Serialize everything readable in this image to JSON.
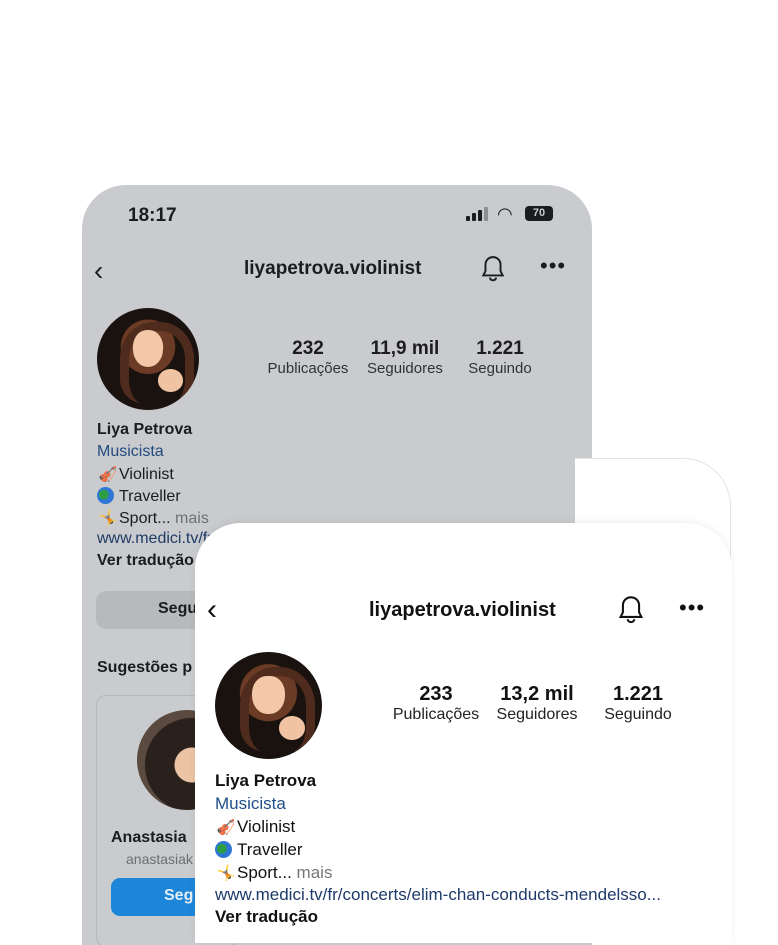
{
  "back_screen": {
    "status": {
      "time": "18:17",
      "battery": "70"
    },
    "header": {
      "username": "liyapetrova.violinist"
    },
    "stats": [
      {
        "value": "232",
        "label": "Publicações"
      },
      {
        "value": "11,9 mil",
        "label": "Seguidores"
      },
      {
        "value": "1.221",
        "label": "Seguindo"
      }
    ],
    "profile": {
      "name": "Liya Petrova",
      "category": "Musicista",
      "bio": [
        {
          "icon": "violin-emoji",
          "text": "Violinist"
        },
        {
          "icon": "globe-emoji",
          "text": "Traveller"
        },
        {
          "icon": "gymnast-emoji",
          "text": "Sport...",
          "more": "mais"
        }
      ],
      "link": "www.medici.tv/fr",
      "translate": "Ver tradução"
    },
    "follow_button_label": "Segu",
    "suggestions": {
      "title": "Sugestões p",
      "card": {
        "name": "Anastasia",
        "handle": "anastasiak",
        "follow_label": "Seg"
      }
    }
  },
  "front_screen": {
    "header": {
      "username": "liyapetrova.violinist"
    },
    "stats": [
      {
        "value": "233",
        "label": "Publicações"
      },
      {
        "value": "13,2 mil",
        "label": "Seguidores"
      },
      {
        "value": "1.221",
        "label": "Seguindo"
      }
    ],
    "profile": {
      "name": "Liya Petrova",
      "category": "Musicista",
      "bio": [
        {
          "icon": "violin-emoji",
          "text": "Violinist"
        },
        {
          "icon": "globe-emoji",
          "text": "Traveller"
        },
        {
          "icon": "gymnast-emoji",
          "text": "Sport...",
          "more": "mais"
        }
      ],
      "link": "www.medici.tv/fr/concerts/elim-chan-conducts-mendelsso...",
      "translate": "Ver tradução"
    }
  },
  "colors": {
    "back_background": "#c9cbcf",
    "front_background": "#ffffff",
    "link": "#1e3a6a",
    "follow_blue": "#1d86d8"
  }
}
